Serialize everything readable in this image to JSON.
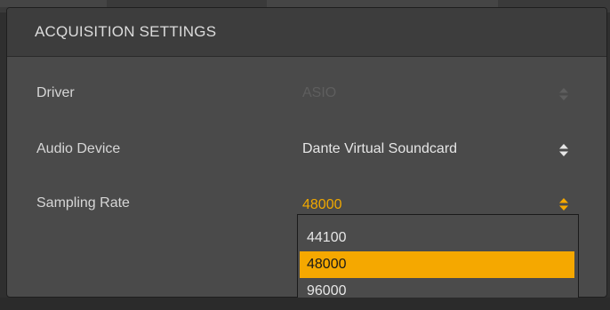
{
  "panel": {
    "title": "ACQUISITION SETTINGS"
  },
  "settings": [
    {
      "label": "Driver",
      "value": "ASIO",
      "state": "disabled"
    },
    {
      "label": "Audio Device",
      "value": "Dante Virtual Soundcard",
      "state": "normal"
    },
    {
      "label": "Sampling Rate",
      "value": "48000",
      "state": "active"
    }
  ],
  "sampling_rate_options": [
    "44100",
    "48000",
    "96000"
  ],
  "selected_option": "48000",
  "colors": {
    "accent": "#f5a800",
    "panel_bg": "#4a4a4a",
    "header_bg": "#3d3d3d",
    "disabled_text": "#5e5e5e"
  },
  "icons": {
    "stepper": "up-down-arrows-icon"
  }
}
